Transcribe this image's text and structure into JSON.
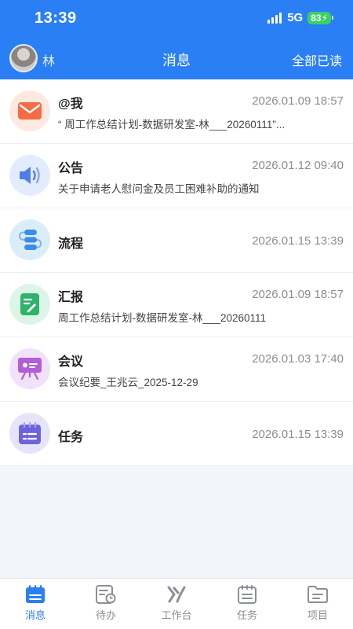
{
  "status_bar": {
    "time": "13:39",
    "network": "5G",
    "battery": "83"
  },
  "header": {
    "username": "林",
    "title": "消息",
    "mark_all_read": "全部已读"
  },
  "messages": [
    {
      "title": "@我",
      "time": "2026.01.09 18:57",
      "preview": "“ 周工作总结计划-数据研发室-林___20260111”...",
      "icon": "mail-icon",
      "color": "#f46b45",
      "bg": "#fde9df"
    },
    {
      "title": "公告",
      "time": "2026.01.12 09:40",
      "preview": "关于申请老人慰问金及员工困难补助的通知",
      "icon": "speaker-icon",
      "color": "#4f7de8",
      "bg": "#e3ecfd"
    },
    {
      "title": "流程",
      "time": "2026.01.15 13:39",
      "preview": "",
      "icon": "flow-icon",
      "color": "#3a8ee6",
      "bg": "#dcedfa"
    },
    {
      "title": "汇报",
      "time": "2026.01.09 18:57",
      "preview": "周工作总结计划-数据研发室-林___20260111",
      "icon": "report-icon",
      "color": "#2fb36b",
      "bg": "#dcf5e7"
    },
    {
      "title": "会议",
      "time": "2026.01.03 17:40",
      "preview": "会议纪要_王兆云_2025-12-29",
      "icon": "presentation-icon",
      "color": "#b15ed8",
      "bg": "#f1e2f9"
    },
    {
      "title": "任务",
      "time": "2026.01.15 13:39",
      "preview": "",
      "icon": "task-icon",
      "color": "#6f63db",
      "bg": "#e7e4fa"
    }
  ],
  "tabs": [
    {
      "label": "消息",
      "icon": "message-tab-icon",
      "active": true
    },
    {
      "label": "待办",
      "icon": "todo-tab-icon",
      "active": false
    },
    {
      "label": "工作台",
      "icon": "workbench-tab-icon",
      "active": false
    },
    {
      "label": "任务",
      "icon": "task-tab-icon",
      "active": false
    },
    {
      "label": "项目",
      "icon": "project-tab-icon",
      "active": false
    }
  ],
  "colors": {
    "primary": "#2a7ff5",
    "background": "#f3f5fa",
    "inactive": "#8c8f95"
  }
}
